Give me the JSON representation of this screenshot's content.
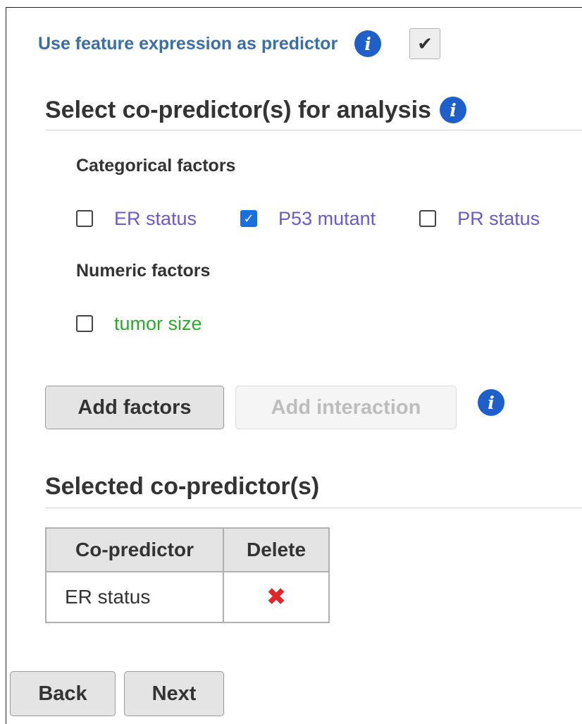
{
  "predictor": {
    "label": "Use feature expression as predictor",
    "info_icon": "info-icon",
    "checked": true,
    "check_glyph": "✔"
  },
  "select_section": {
    "title": "Select co-predictor(s) for analysis",
    "info_icon": "info-icon"
  },
  "categorical": {
    "heading": "Categorical factors",
    "items": [
      {
        "label": "ER status",
        "checked": false
      },
      {
        "label": "P53 mutant",
        "checked": true
      },
      {
        "label": "PR status",
        "checked": false
      }
    ]
  },
  "numeric": {
    "heading": "Numeric factors",
    "items": [
      {
        "label": "tumor size",
        "checked": false
      }
    ]
  },
  "actions": {
    "add_factors": "Add factors",
    "add_interaction": "Add interaction",
    "info_icon": "info-icon"
  },
  "selected_section": {
    "title": "Selected co-predictor(s)"
  },
  "table": {
    "headers": [
      "Co-predictor",
      "Delete"
    ],
    "rows": [
      {
        "co_predictor": "ER status",
        "delete_icon": "close-x-icon",
        "delete_glyph": "✖"
      }
    ]
  },
  "nav": {
    "back": "Back",
    "next": "Next"
  },
  "colors": {
    "info_blue": "#1f5fc9",
    "categorical_label": "#6a5acd",
    "numeric_label": "#2ea82e",
    "delete_red": "#e0262a",
    "predictor_label": "#3a6ea5"
  }
}
